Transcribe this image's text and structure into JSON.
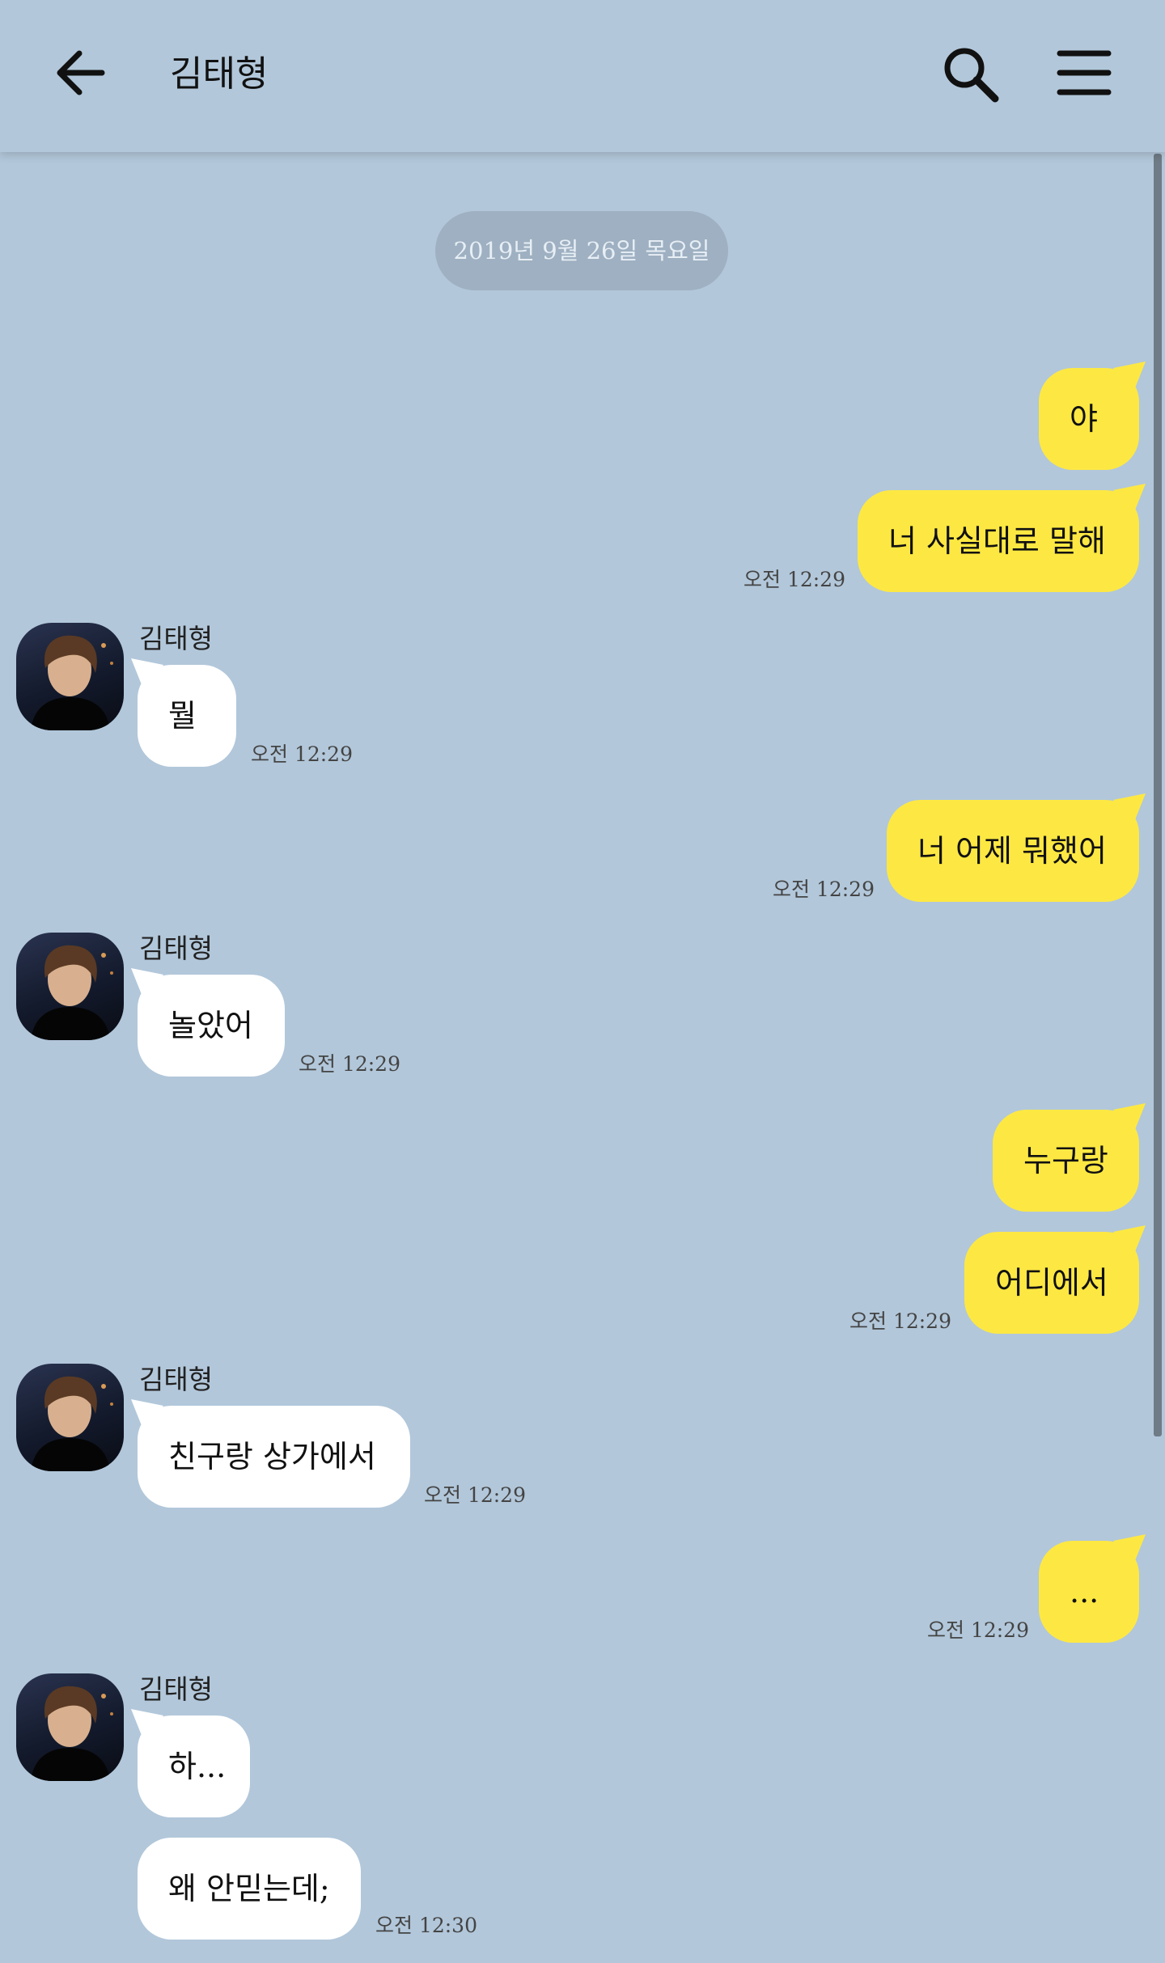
{
  "header": {
    "title": "김태형",
    "back_icon": "arrow-left-icon",
    "search_icon": "search-icon",
    "menu_icon": "hamburger-menu-icon"
  },
  "date_divider": "2019년 9월 26일 목요일",
  "colors": {
    "background": "#b2c7da",
    "my_bubble": "#fde843",
    "their_bubble": "#ffffff"
  },
  "messages": [
    {
      "from": "me",
      "text": "야"
    },
    {
      "from": "me",
      "text": "너 사실대로 말해",
      "time": "오전 12:29"
    },
    {
      "from": "them",
      "sender": "김태형",
      "text": "뭘",
      "time": "오전 12:29"
    },
    {
      "from": "me",
      "text": "너 어제 뭐했어",
      "time": "오전 12:29"
    },
    {
      "from": "them",
      "sender": "김태형",
      "text": "놀았어",
      "time": "오전 12:29"
    },
    {
      "from": "me",
      "text": "누구랑"
    },
    {
      "from": "me",
      "text": "어디에서",
      "time": "오전 12:29"
    },
    {
      "from": "them",
      "sender": "김태형",
      "text": "친구랑 상가에서",
      "time": "오전 12:29"
    },
    {
      "from": "me",
      "text": "...",
      "time": "오전 12:29"
    },
    {
      "from": "them",
      "sender": "김태형",
      "text": "하..."
    },
    {
      "from": "them",
      "text": "왜 안믿는데;",
      "time": "오전 12:30"
    }
  ]
}
